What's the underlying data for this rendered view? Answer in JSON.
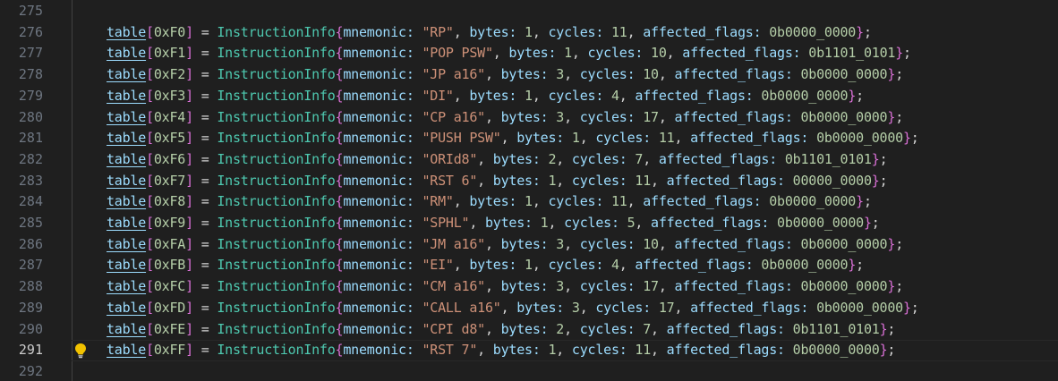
{
  "editor": {
    "line_numbers": [
      "275",
      "276",
      "277",
      "278",
      "279",
      "280",
      "281",
      "282",
      "283",
      "284",
      "285",
      "286",
      "287",
      "288",
      "289",
      "290",
      "291",
      "292"
    ],
    "active_line": "291",
    "lightbulb_icon": "lightbulb-icon",
    "lines": [
      {
        "num": "275",
        "empty": true
      },
      {
        "num": "276",
        "var": "table",
        "index": "0xF0",
        "type": "InstructionInfo",
        "mnemonic": "\"RP\"",
        "bytes": "1",
        "cycles": "11",
        "flags": "0b0000_0000"
      },
      {
        "num": "277",
        "var": "table",
        "index": "0xF1",
        "type": "InstructionInfo",
        "mnemonic": "\"POP PSW\"",
        "bytes": "1",
        "cycles": "10",
        "flags": "0b1101_0101"
      },
      {
        "num": "278",
        "var": "table",
        "index": "0xF2",
        "type": "InstructionInfo",
        "mnemonic": "\"JP a16\"",
        "bytes": "3",
        "cycles": "10",
        "flags": "0b0000_0000"
      },
      {
        "num": "279",
        "var": "table",
        "index": "0xF3",
        "type": "InstructionInfo",
        "mnemonic": "\"DI\"",
        "bytes": "1",
        "cycles": "4",
        "flags": "0b0000_0000"
      },
      {
        "num": "280",
        "var": "table",
        "index": "0xF4",
        "type": "InstructionInfo",
        "mnemonic": "\"CP a16\"",
        "bytes": "3",
        "cycles": "17",
        "flags": "0b0000_0000"
      },
      {
        "num": "281",
        "var": "table",
        "index": "0xF5",
        "type": "InstructionInfo",
        "mnemonic": "\"PUSH PSW\"",
        "bytes": "1",
        "cycles": "11",
        "flags": "0b0000_0000"
      },
      {
        "num": "282",
        "var": "table",
        "index": "0xF6",
        "type": "InstructionInfo",
        "mnemonic": "\"ORId8\"",
        "bytes": "2",
        "cycles": "7",
        "flags": "0b1101_0101"
      },
      {
        "num": "283",
        "var": "table",
        "index": "0xF7",
        "type": "InstructionInfo",
        "mnemonic": "\"RST 6\"",
        "bytes": "1",
        "cycles": "11",
        "flags": "00000_0000"
      },
      {
        "num": "284",
        "var": "table",
        "index": "0xF8",
        "type": "InstructionInfo",
        "mnemonic": "\"RM\"",
        "bytes": "1",
        "cycles": "11",
        "flags": "0b0000_0000"
      },
      {
        "num": "285",
        "var": "table",
        "index": "0xF9",
        "type": "InstructionInfo",
        "mnemonic": "\"SPHL\"",
        "bytes": "1",
        "cycles": "5",
        "flags": "0b0000_0000"
      },
      {
        "num": "286",
        "var": "table",
        "index": "0xFA",
        "type": "InstructionInfo",
        "mnemonic": "\"JM a16\"",
        "bytes": "3",
        "cycles": "10",
        "flags": "0b0000_0000"
      },
      {
        "num": "287",
        "var": "table",
        "index": "0xFB",
        "type": "InstructionInfo",
        "mnemonic": "\"EI\"",
        "bytes": "1",
        "cycles": "4",
        "flags": "0b0000_0000"
      },
      {
        "num": "288",
        "var": "table",
        "index": "0xFC",
        "type": "InstructionInfo",
        "mnemonic": "\"CM a16\"",
        "bytes": "3",
        "cycles": "17",
        "flags": "0b0000_0000"
      },
      {
        "num": "289",
        "var": "table",
        "index": "0xFD",
        "type": "InstructionInfo",
        "mnemonic": "\"CALL a16\"",
        "bytes": "3",
        "cycles": "17",
        "flags": "0b0000_0000"
      },
      {
        "num": "290",
        "var": "table",
        "index": "0xFE",
        "type": "InstructionInfo",
        "mnemonic": "\"CPI d8\"",
        "bytes": "2",
        "cycles": "7",
        "flags": "0b1101_0101"
      },
      {
        "num": "291",
        "var": "table",
        "index": "0xFF",
        "type": "InstructionInfo",
        "mnemonic": "\"RST 7\"",
        "bytes": "1",
        "cycles": "11",
        "flags": "0b0000_0000"
      },
      {
        "num": "292",
        "empty": true
      }
    ],
    "tokens": {
      "eq": " = ",
      "open_bracket": "[",
      "close_bracket": "]",
      "open_brace": "{",
      "close_brace": "}",
      "semicolon": ";",
      "comma_sep": ", ",
      "k_mnemonic": "mnemonic: ",
      "k_bytes": "bytes: ",
      "k_cycles": "cycles: ",
      "k_flags": "affected_flags: "
    },
    "colors": {
      "background": "#1f1f1f",
      "line_number": "#6e7681",
      "line_number_active": "#cccccc",
      "variable": "#9cdcfe",
      "type": "#4ec9b0",
      "string": "#ce9178",
      "number": "#b5cea8",
      "bracket": "#da70d6",
      "lightbulb": "#f2c200"
    }
  }
}
